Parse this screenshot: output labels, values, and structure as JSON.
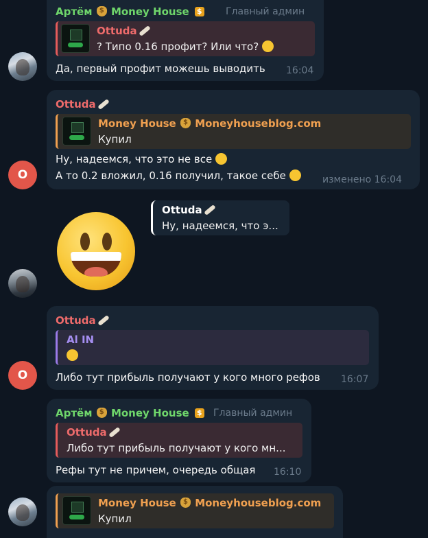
{
  "messages": [
    {
      "sender": "Артём",
      "sender_suffix": "Money House",
      "role": "Главный админ",
      "reply": {
        "name": "Ottuda",
        "text": "? Типо 0.16 профит? Или что?"
      },
      "text": "Да, первый профит можешь выводить",
      "time": "16:04"
    },
    {
      "sender": "Ottuda",
      "reply": {
        "name_left": "Money House",
        "name_right": "Moneyhouseblog.com",
        "text": "Купил"
      },
      "lines": [
        "Ну, надеемся, что это не все",
        "А то 0.2 вложил, 0.16 получил, такое себе"
      ],
      "time": "изменено 16:04",
      "avatar_letter": "O"
    },
    {
      "reply": {
        "name": "Ottuda",
        "text": "Ну, надеемся, что э..."
      },
      "sticker": "smiling-face-sticker"
    },
    {
      "sender": "Ottuda",
      "reply": {
        "name": "Al IN"
      },
      "text": "Либо тут прибыль получают у кого много рефов",
      "time": "16:07",
      "avatar_letter": "O"
    },
    {
      "sender": "Артём",
      "sender_suffix": "Money House",
      "role": "Главный админ",
      "reply": {
        "name": "Ottuda",
        "text": "Либо тут прибыль получают у кого мн..."
      },
      "text": "Рефы тут не причем, очередь общая",
      "time": "16:10"
    },
    {
      "reply": {
        "name_left": "Money House",
        "name_right": "Moneyhouseblog.com",
        "text": "Купил"
      }
    }
  ],
  "colors": {
    "background": "#0e1621",
    "bubble": "#182533",
    "admin_name": "#6fd66b",
    "user_name": "#ee6b6b",
    "channel_name": "#f0a050"
  }
}
